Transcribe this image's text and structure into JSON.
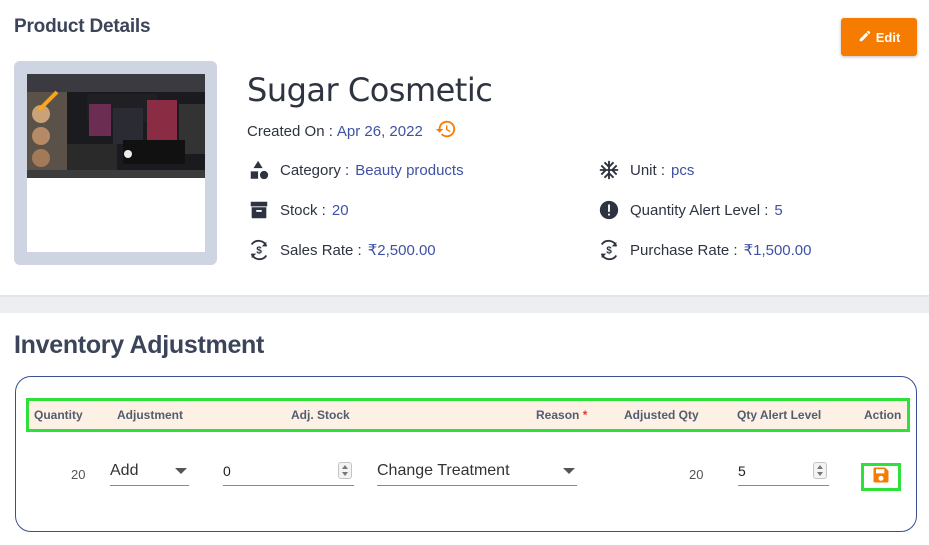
{
  "product": {
    "section_title": "Product Details",
    "edit_label": "Edit",
    "name": "Sugar Cosmetic",
    "created_label": "Created On :",
    "created_value": "Apr 26, 2022",
    "category_label": "Category :",
    "category_value": "Beauty products",
    "unit_label": "Unit :",
    "unit_value": "pcs",
    "stock_label": "Stock :",
    "stock_value": "20",
    "alert_label": "Quantity Alert Level :",
    "alert_value": "5",
    "sales_label": "Sales Rate :",
    "sales_value": "₹2,500.00",
    "purchase_label": "Purchase Rate :",
    "purchase_value": "₹1,500.00"
  },
  "inventory": {
    "title": "Inventory Adjustment",
    "headers": {
      "quantity": "Quantity",
      "adjustment": "Adjustment",
      "adj_stock": "Adj. Stock",
      "reason": "Reason",
      "reason_required": "*",
      "adjusted_qty": "Adjusted Qty",
      "qty_alert": "Qty Alert Level",
      "action": "Action"
    },
    "row": {
      "quantity": "20",
      "adjustment": "Add",
      "adj_stock": "0",
      "reason": "Change Treatment",
      "adjusted_qty": "20",
      "qty_alert": "5"
    }
  },
  "colors": {
    "accent_orange": "#f57c00",
    "link_blue": "#3f51a5",
    "highlight_green": "#2ee03a"
  },
  "icons": [
    "pencil-icon",
    "history-icon",
    "shapes-icon",
    "archive-icon",
    "currency-exchange-icon",
    "snowflake-icon",
    "alert-circle-icon",
    "save-icon"
  ]
}
